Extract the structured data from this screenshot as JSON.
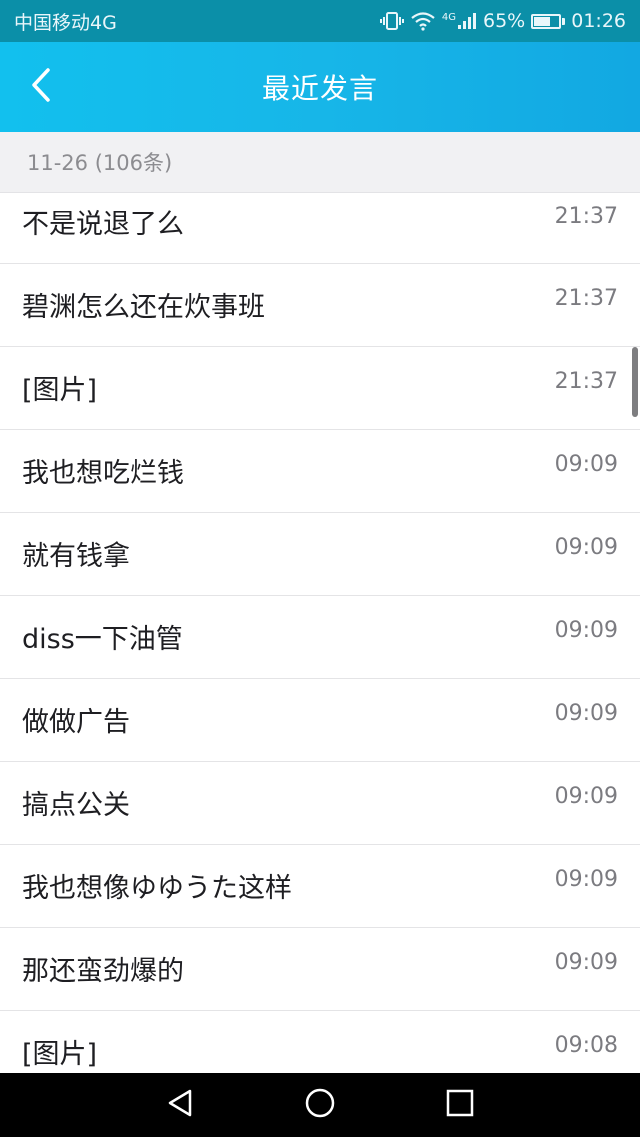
{
  "status_bar": {
    "carrier": "中国移动4G",
    "network_label": "4G",
    "battery": "65%",
    "battery_level": 0.65,
    "time": "01:26",
    "icons": [
      "vibrate-icon",
      "wifi-icon",
      "signal-icon",
      "battery-icon"
    ]
  },
  "header": {
    "back_icon": "chevron-left-icon",
    "title": "最近发言"
  },
  "section": {
    "label": "11-26 (106条)"
  },
  "messages": [
    {
      "text": "不是说退了么",
      "time": "21:37"
    },
    {
      "text": "碧渊怎么还在炊事班",
      "time": "21:37"
    },
    {
      "text": "[图片]",
      "time": "21:37"
    },
    {
      "text": "我也想吃烂钱",
      "time": "09:09"
    },
    {
      "text": "就有钱拿",
      "time": "09:09"
    },
    {
      "text": "diss一下油管",
      "time": "09:09"
    },
    {
      "text": "做做广告",
      "time": "09:09"
    },
    {
      "text": "搞点公关",
      "time": "09:09"
    },
    {
      "text": "我也想像ゆゆうた这样",
      "time": "09:09"
    },
    {
      "text": "那还蛮劲爆的",
      "time": "09:09"
    },
    {
      "text": "[图片]",
      "time": "09:08"
    }
  ],
  "nav_bar": {
    "icons": [
      "back-triangle-icon",
      "home-circle-icon",
      "recents-square-icon"
    ]
  },
  "colors": {
    "status_bar": "#0b8fa8",
    "header_gradient_start": "#12c0ee",
    "header_gradient_end": "#12a8e2",
    "section_bg": "#f1f1f3",
    "text": "#1e1e22",
    "time_text": "#7b7b80"
  }
}
